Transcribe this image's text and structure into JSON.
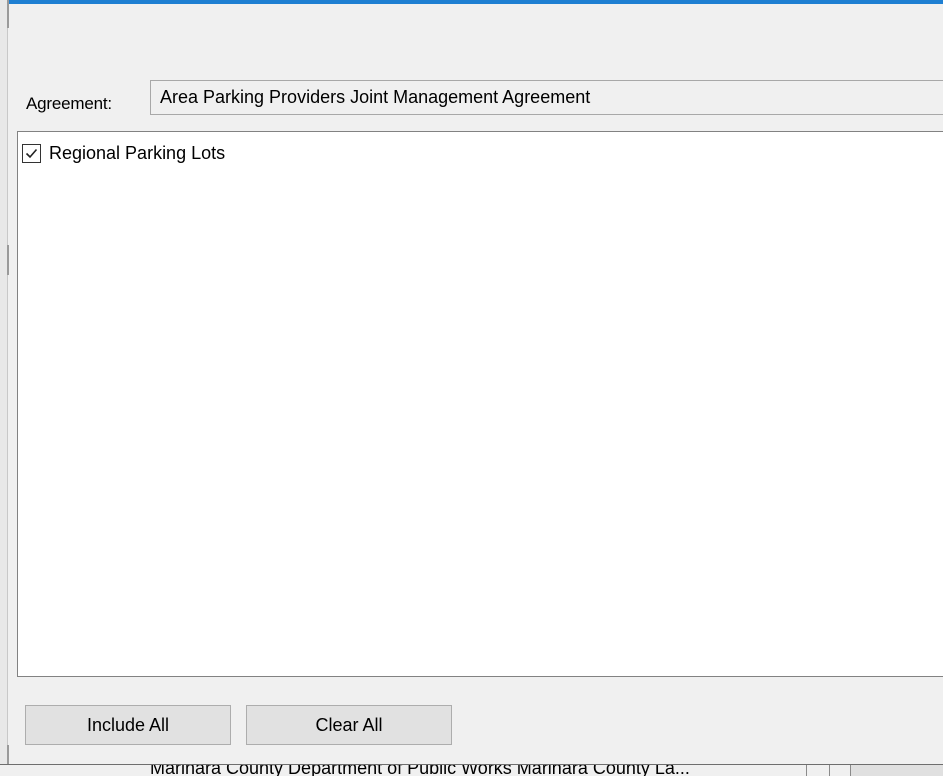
{
  "agreement": {
    "label": "Agreement:",
    "value": "Area Parking Providers Joint Management Agreement"
  },
  "list": {
    "items": [
      {
        "label": "Regional Parking Lots",
        "checked": true
      }
    ]
  },
  "buttons": {
    "include_all": "Include All",
    "clear_all": "Clear All"
  },
  "background_window": {
    "text": "Marinara County Department of Public Works Marinara County La..."
  },
  "colors": {
    "window_accent": "#1e7fd2",
    "panel_bg": "#f0f0f0",
    "list_bg": "#ffffff",
    "button_bg": "#e1e1e1"
  }
}
